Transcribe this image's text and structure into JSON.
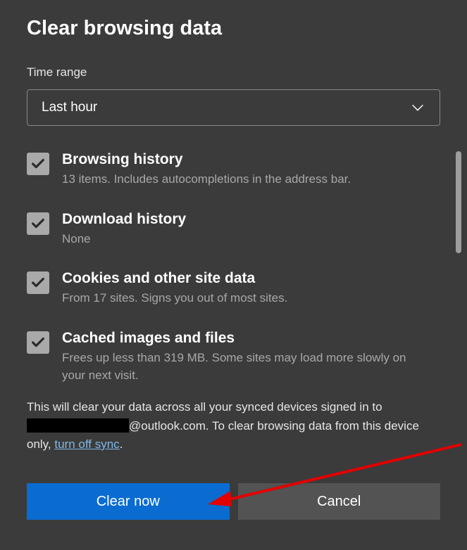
{
  "dialog": {
    "title": "Clear browsing data",
    "time_range": {
      "label": "Time range",
      "selected": "Last hour"
    },
    "options": [
      {
        "id": "browsing-history",
        "title": "Browsing history",
        "desc": "13 items. Includes autocompletions in the address bar.",
        "checked": true
      },
      {
        "id": "download-history",
        "title": "Download history",
        "desc": "None",
        "checked": true
      },
      {
        "id": "cookies",
        "title": "Cookies and other site data",
        "desc": "From 17 sites. Signs you out of most sites.",
        "checked": true
      },
      {
        "id": "cached",
        "title": "Cached images and files",
        "desc": "Frees up less than 319 MB. Some sites may load more slowly on your next visit.",
        "checked": true
      }
    ],
    "sync_notice": {
      "part1": "This will clear your data across all your synced devices signed in to ",
      "email_suffix": "@outlook.com. To clear browsing data from this device only, ",
      "link_text": "turn off sync",
      "part3": "."
    },
    "buttons": {
      "primary": "Clear now",
      "secondary": "Cancel"
    }
  },
  "annotation": {
    "arrow_color": "#e20000"
  }
}
